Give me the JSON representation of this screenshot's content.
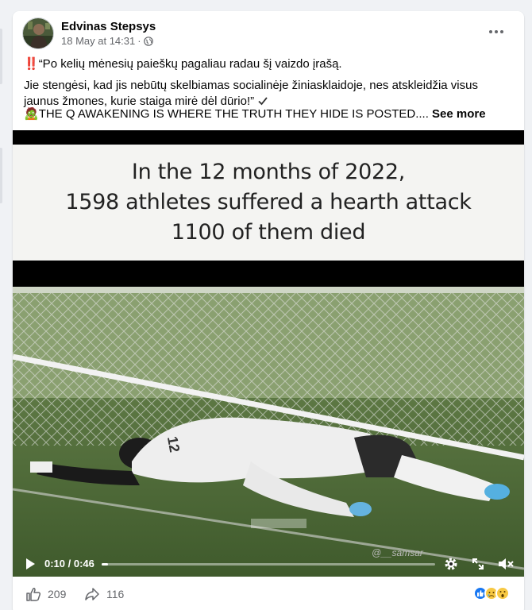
{
  "post": {
    "author": "Edvinas Stepsys",
    "date": "18 May at 14:31",
    "separator": "·",
    "privacy_icon": "globe-icon",
    "more_icon": "more-options-icon"
  },
  "body": {
    "line1_emoji": "‼️",
    "line1": "“Po kelių mėnesių paieškų pagaliau radau šį vaizdo įrašą.",
    "line2": "Jie stengėsi, kad jis nebūtų skelbiamas socialinėje žiniasklaidoje, nes atskleidžia visus jaunus žmones, kurie staiga mirė dėl dūrio!”",
    "line3_emoji": "🧟",
    "line3": "THE Q AWAKENING IS WHERE THE TRUTH THEY HIDE IS POSTED....",
    "see_more": "See more"
  },
  "video": {
    "caption_line1": "In the 12 months of 2022,",
    "caption_line2": "1598 athletes suffered a hearth attack",
    "caption_line3": "1100 of them died",
    "jersey_number": "12",
    "watermark": "@__samsar",
    "time": "0:10 / 0:46",
    "progress_fraction": 0.02,
    "controls": {
      "play_icon": "play-icon",
      "settings_icon": "gear-icon",
      "fullscreen_icon": "expand-icon",
      "mute_icon": "mute-icon"
    }
  },
  "footer": {
    "likes": "209",
    "shares": "116",
    "reactions": [
      "like",
      "sad",
      "wow"
    ]
  },
  "colors": {
    "accent": "#1877f2",
    "meta_text": "#65676b",
    "page_bg": "#f0f2f5"
  }
}
